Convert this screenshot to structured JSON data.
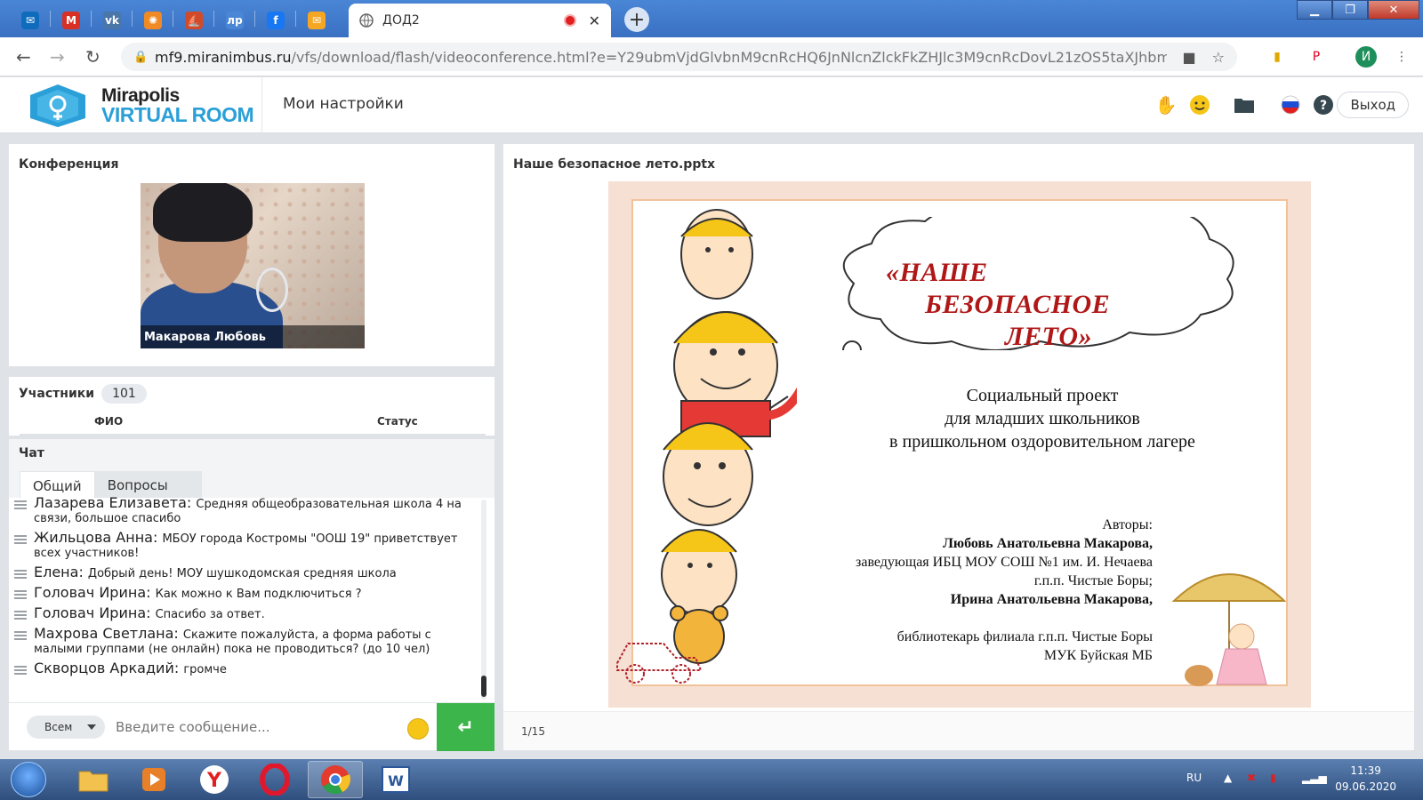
{
  "browser": {
    "active_tab_title": "ДОД2",
    "pinned_tabs": [
      {
        "icon": "outlook-icon",
        "glyph": "✉",
        "color": "#0f6cbd"
      },
      {
        "icon": "gmail-icon",
        "glyph": "M",
        "color": "#d93025"
      },
      {
        "icon": "vk-icon",
        "glyph": "vk",
        "color": "#4a76a8"
      },
      {
        "icon": "sun-icon",
        "glyph": "✺",
        "color": "#f08a24"
      },
      {
        "icon": "ship-icon",
        "glyph": "⛵",
        "color": "#d14a2a"
      },
      {
        "icon": "lr-icon",
        "glyph": "лр",
        "color": "#4a86d6"
      },
      {
        "icon": "facebook-icon",
        "glyph": "f",
        "color": "#1877f2"
      },
      {
        "icon": "mail-envelope-icon",
        "glyph": "✉",
        "color": "#f5a623"
      }
    ],
    "url_host": "mf9.miranimbus.ru",
    "url_path": "/vfs/download/flash/videoconference.html?e=Y29ubmVjdGlvbnM9cnRcHQ6JnNlcnZlckFkZHJlc3M9cnRcDovL21zOS5taXJhbml...",
    "profile_initial": "И"
  },
  "app": {
    "logo_line1": "Mirapolis",
    "logo_line2": "VIRTUAL ROOM",
    "menu_settings": "Мои настройки",
    "exit_label": "Выход"
  },
  "conference": {
    "title": "Конференция",
    "speaker_name": "Макарова Любовь"
  },
  "participants": {
    "title": "Участники",
    "count": "101",
    "col_name": "ФИО",
    "col_status": "Статус"
  },
  "chat": {
    "title": "Чат",
    "tab_general": "Общий",
    "tab_questions": "Вопросы",
    "messages": [
      {
        "author": "Лазарева  Елизавета:",
        "text": "Средняя общеобразовательная школа 4 на связи, большое спасибо"
      },
      {
        "author": "Жильцова Анна:",
        "text": "МБОУ города Костромы \"ООШ 19\" приветствует всех участников!"
      },
      {
        "author": "Елена:",
        "text": "Добрый день! МОУ шушкодомская средняя школа"
      },
      {
        "author": "Головач Ирина:",
        "text": "Как можно к Вам подключиться ?"
      },
      {
        "author": "Головач Ирина:",
        "text": "Спасибо за ответ."
      },
      {
        "author": "Махрова Светлана:",
        "text": "Скажите пожалуйста, а форма работы с малыми группами (не онлайн) пока не проводиться? (до 10 чел)"
      },
      {
        "author": "Скворцов Аркадий:",
        "text": "громче"
      }
    ],
    "recipient": "Всем",
    "input_placeholder": "Введите сообщение..."
  },
  "presentation": {
    "file_name": "Наше безопасное лето.pptx",
    "title_line1": "«НАШЕ",
    "title_line2": "БЕЗОПАСНОЕ",
    "title_line3": "ЛЕТО»",
    "subtitle_line1": "Социальный проект",
    "subtitle_line2": "для младших школьников",
    "subtitle_line3": "в пришкольном оздоровительном лагере",
    "authors_label": "Авторы:",
    "author1_name": "Любовь Анатольевна Макарова,",
    "author1_role": "заведующая ИБЦ  МОУ СОШ №1 им. И. Нечаева",
    "author1_place": "г.п.п. Чистые Боры;",
    "author2_name": "Ирина Анатольевна Макарова,",
    "author2_role": "библиотекарь филиала  г.п.п. Чистые Боры",
    "author2_org": "МУК Буйская МБ",
    "page_indicator": "1/15"
  },
  "taskbar": {
    "language": "RU",
    "time": "11:39",
    "date": "09.06.2020"
  }
}
